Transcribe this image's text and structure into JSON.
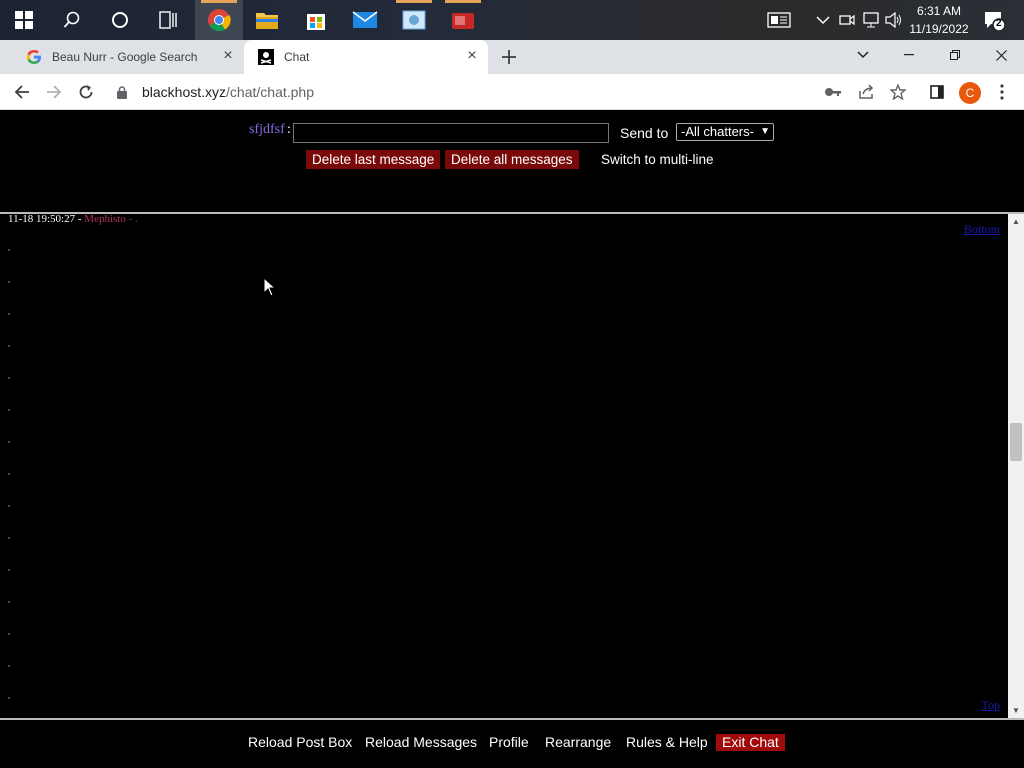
{
  "taskbar": {
    "time": "6:31 AM",
    "date": "11/19/2022",
    "notification_count": "2"
  },
  "tabs": [
    {
      "title": "Beau Nurr - Google Search",
      "icon": "google-icon"
    },
    {
      "title": "Chat",
      "icon": "pirate-icon",
      "active": true
    }
  ],
  "address": {
    "host": "blackhost.xyz",
    "path": "/chat/chat.php",
    "profile_initial": "C"
  },
  "postbox": {
    "nickname": "sfjdfsf",
    "colon": ":",
    "message_value": "",
    "send_to_label": "Send to",
    "recipient_selected": "-All chatters-",
    "delete_last_label": "Delete last message",
    "delete_all_label": "Delete all messages",
    "multiline_label": "Switch to multi-line"
  },
  "messages": {
    "lines": [
      {
        "time": "11-18 19:50:27",
        "sep": " - ",
        "user": "Mephisto",
        "tail": " - ."
      }
    ],
    "top_link": "Bottom",
    "bottom_link": "Top"
  },
  "controls": {
    "reload_post_box": "Reload Post Box",
    "reload_messages": "Reload Messages",
    "profile": "Profile",
    "rearrange": "Rearrange",
    "rules_help": "Rules & Help",
    "exit_chat": "Exit Chat"
  },
  "colors": {
    "nickname": "#8a6be8",
    "button_red": "#7a0a0a",
    "exit_red": "#a00a0a",
    "background": "#000000"
  }
}
